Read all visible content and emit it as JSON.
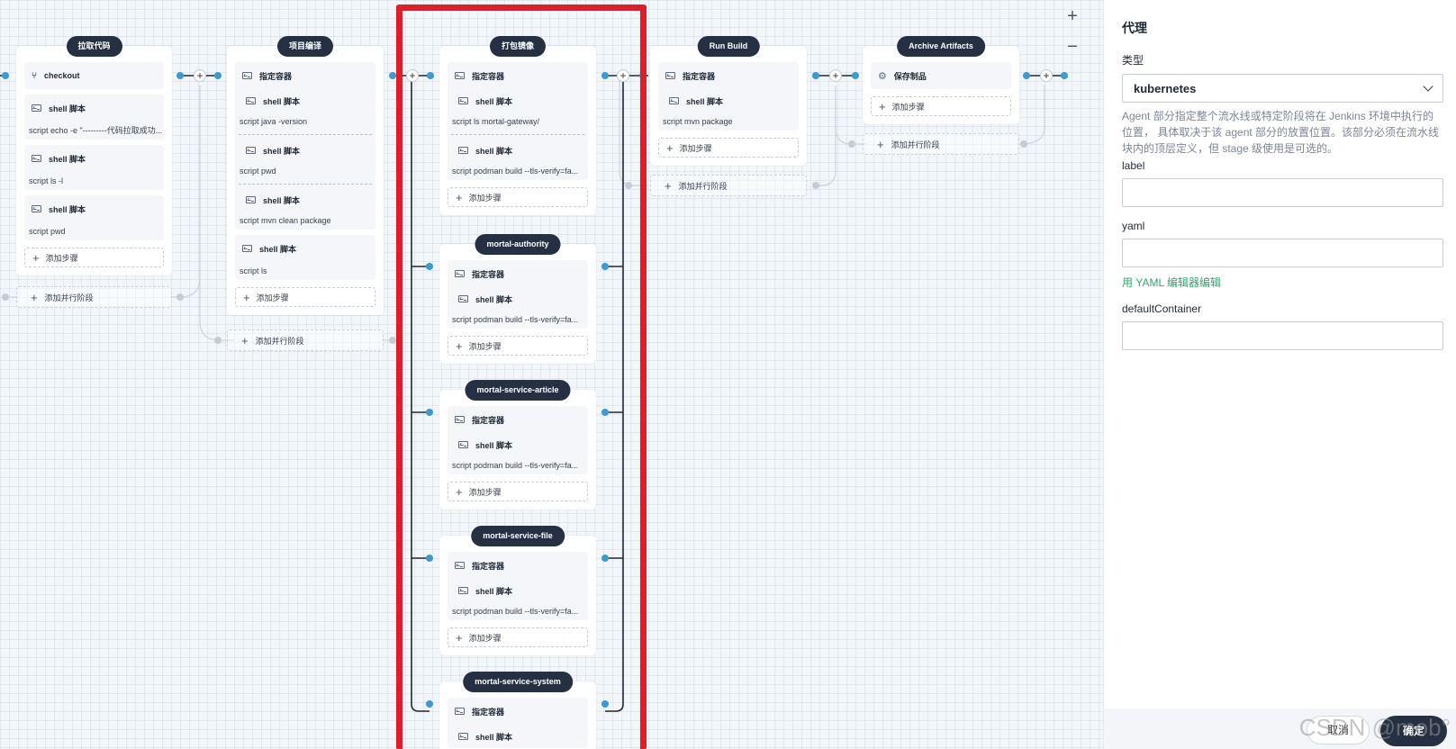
{
  "canvas": {
    "zoom_in": "+",
    "zoom_out": "−",
    "add_step": "添加步骤",
    "add_parallel": "添加并行阶段",
    "stage1": {
      "title": "拉取代码",
      "s0": "checkout",
      "s1": "shell 脚本",
      "s1_script": "script   echo -e \"---------代码拉取成功...",
      "s2": "shell 脚本",
      "s2_script": "script   ls -l",
      "s3": "shell 脚本",
      "s3_script": "script   pwd"
    },
    "stage2": {
      "title": "项目编译",
      "c0": "指定容器",
      "s1": "shell 脚本",
      "s1_script": "script   java -version",
      "s2": "shell 脚本",
      "s2_script": "script   pwd",
      "s3": "shell 脚本",
      "s3_script": "script   mvn clean package",
      "s4": "shell 脚本",
      "s4_script": "script   ls"
    },
    "stage3": {
      "title": "打包镜像",
      "container": "指定容器",
      "shell": "shell 脚本",
      "gw_script": "script   ls mortal-gateway/",
      "podman_script": "script   podman build --tls-verify=fa...",
      "b1": "mortal-authority",
      "b2": "mortal-service-article",
      "b3": "mortal-service-file",
      "b4": "mortal-service-system"
    },
    "stage4": {
      "title": "Run Build",
      "c0": "指定容器",
      "s1": "shell 脚本",
      "s1_script": "script   mvn package"
    },
    "stage5": {
      "title": "Archive Artifacts",
      "s0": "保存制品"
    }
  },
  "panel": {
    "title": "代理",
    "type_label": "类型",
    "type_value": "kubernetes",
    "help": "Agent 部分指定整个流水线或特定阶段将在 Jenkins 环境中执行的位置， 具体取决于该 agent 部分的放置位置。该部分必须在流水线块内的顶层定义，但 stage 级使用是可选的。",
    "label_label": "label",
    "label_value": "",
    "yaml_label": "yaml",
    "yaml_value": "",
    "yaml_link": "用 YAML 编辑器编辑",
    "default_container_label": "defaultContainer",
    "default_container_value": "",
    "cancel": "取消",
    "ok": "确定"
  },
  "watermark": "CSDN @mob°",
  "colors": {
    "highlight": "#e21d2a",
    "node": "#3a9bd1",
    "pill": "#253043",
    "link": "#2fa56e"
  }
}
